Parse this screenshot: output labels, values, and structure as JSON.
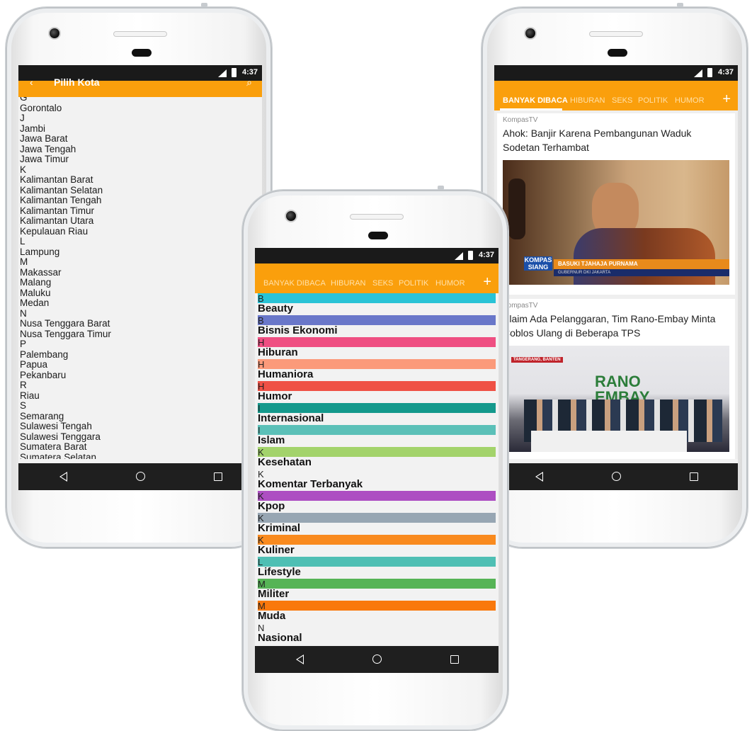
{
  "status": {
    "time": "4:37"
  },
  "nav_icons": {
    "back": "back-triangle-icon",
    "home": "home-circle-icon",
    "recents": "recents-square-icon"
  },
  "colors": {
    "accent": "#fa9f0c",
    "status_bar": "#1a1a1a",
    "nav_bar": "#1f1f1f"
  },
  "left_phone": {
    "appbar_title": "Pilih Kota",
    "items": [
      "G",
      "Gorontalo",
      "J",
      "Jambi",
      "Jawa Barat",
      "Jawa Tengah",
      "Jawa Timur",
      "K",
      "Kalimantan Barat",
      "Kalimantan Selatan",
      "Kalimantan Tengah",
      "Kalimantan Timur",
      "Kalimantan Utara",
      "Kepulauan Riau",
      "L",
      "Lampung",
      "M",
      "Makassar",
      "Malang",
      "Maluku",
      "Medan",
      "N",
      "Nusa Tenggara Barat",
      "Nusa Tenggara Timur",
      "P",
      "Palembang",
      "Papua",
      "Pekanbaru",
      "R",
      "Riau",
      "S",
      "Semarang",
      "Sulawesi Tengah",
      "Sulawesi Tenggara",
      "Sumatera Barat",
      "Sumatera Selatan"
    ]
  },
  "tabs": [
    "BANYAK DIBACA",
    "HIBURAN",
    "SEKS",
    "POLITIK",
    "HUMOR"
  ],
  "plus_label": "+",
  "center_phone": {
    "categories": [
      {
        "letter": "B",
        "name": "Beauty",
        "color": "#29c3d6"
      },
      {
        "letter": "B",
        "name": "Bisnis Ekonomi",
        "color": "#6977c9"
      },
      {
        "letter": "H",
        "name": "Hiburan",
        "color": "#ef4f82"
      },
      {
        "letter": "H",
        "name": "Humaniora",
        "color": "#fb9a7a"
      },
      {
        "letter": "H",
        "name": "Humor",
        "color": "#ef5145"
      },
      {
        "letter": "I",
        "name": "Internasional",
        "color": "#14998c"
      },
      {
        "letter": "I",
        "name": "Islam",
        "color": "#5bc0b8"
      },
      {
        "letter": "K",
        "name": "Kesehatan",
        "color": "#a3d36b"
      },
      {
        "letter": "K",
        "name": "Komentar Terbanyak",
        "color": "#f2f2f2"
      },
      {
        "letter": "K",
        "name": "Kpop",
        "color": "#ad4ec2"
      },
      {
        "letter": "K",
        "name": "Kriminal",
        "color": "#97a6b3"
      },
      {
        "letter": "K",
        "name": "Kuliner",
        "color": "#f98a1e"
      },
      {
        "letter": "L",
        "name": "Lifestyle",
        "color": "#4fbfb4"
      },
      {
        "letter": "M",
        "name": "Militer",
        "color": "#56b456"
      },
      {
        "letter": "M",
        "name": "Muda",
        "color": "#f9780c"
      },
      {
        "letter": "N",
        "name": "Nasional",
        "color": "#f2f2f2"
      }
    ]
  },
  "right_phone": {
    "news": [
      {
        "source": "KompasTV",
        "title": "Ahok: Banjir Karena Pembangunan Waduk Sodetan Terhambat",
        "caption1": "KOMPAS SIANG",
        "caption2": "BASUKI TJAHAJA PURNAMA",
        "caption3": "GUBERNUR DKI JAKARTA"
      },
      {
        "source": "KompasTV",
        "title": "Klaim Ada Pelanggaran, Tim Rano-Embay Minta Coblos Ulang di Beberapa TPS",
        "caption1": "TANGERANG, BANTEN",
        "caption2": "RANO EMBAY"
      }
    ]
  }
}
